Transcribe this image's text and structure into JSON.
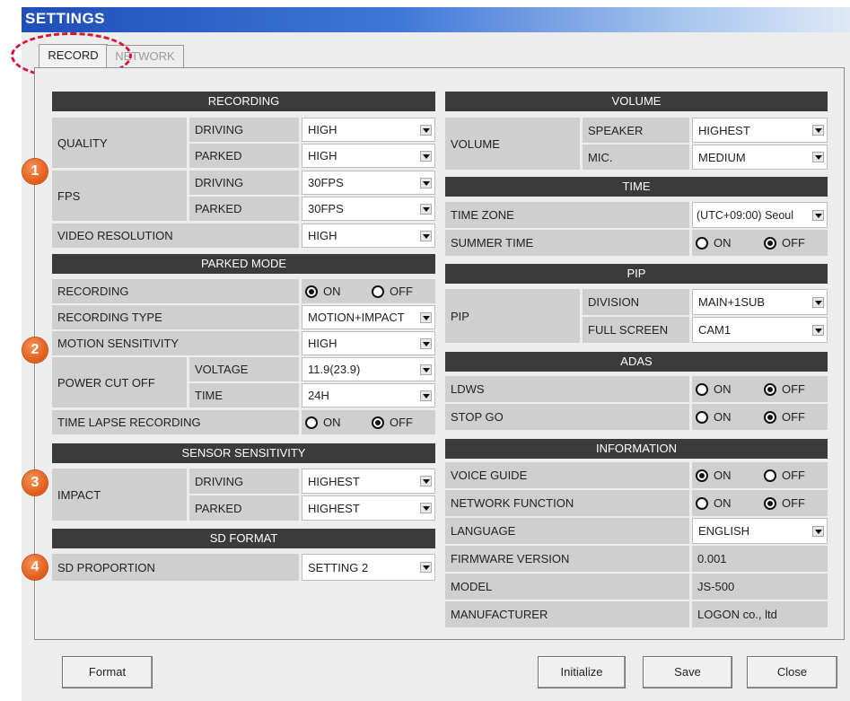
{
  "window": {
    "title": "SETTINGS"
  },
  "tabs": [
    {
      "label": "RECORD"
    },
    {
      "label": "NETWORK"
    }
  ],
  "badges": [
    "1",
    "2",
    "3",
    "4"
  ],
  "left": {
    "recording": {
      "header": "RECORDING",
      "quality_label": "QUALITY",
      "driving_label": "DRIVING",
      "parked_label": "PARKED",
      "quality_driving": "HIGH",
      "quality_parked": "HIGH",
      "fps_label": "FPS",
      "fps_driving": "30FPS",
      "fps_parked": "30FPS",
      "video_resolution_label": "VIDEO RESOLUTION",
      "video_resolution": "HIGH"
    },
    "parked_mode": {
      "header": "PARKED MODE",
      "recording_label": "RECORDING",
      "recording_on": "ON",
      "recording_off": "OFF",
      "recording_type_label": "RECORDING TYPE",
      "recording_type": "MOTION+IMPACT",
      "motion_sensitivity_label": "MOTION SENSITIVITY",
      "motion_sensitivity": "HIGH",
      "power_cut_off_label": "POWER CUT OFF",
      "voltage_label": "VOLTAGE",
      "voltage": "11.9(23.9)",
      "time_label": "TIME",
      "time": "24H",
      "time_lapse_label": "TIME LAPSE RECORDING",
      "time_lapse_on": "ON",
      "time_lapse_off": "OFF"
    },
    "sensor": {
      "header": "SENSOR SENSITIVITY",
      "impact_label": "IMPACT",
      "driving_label": "DRIVING",
      "parked_label": "PARKED",
      "impact_driving": "HIGHEST",
      "impact_parked": "HIGHEST"
    },
    "sd_format": {
      "header": "SD FORMAT",
      "proportion_label": "SD PROPORTION",
      "proportion": "SETTING 2"
    }
  },
  "right": {
    "volume": {
      "header": "VOLUME",
      "volume_label": "VOLUME",
      "speaker_label": "SPEAKER",
      "speaker": "HIGHEST",
      "mic_label": "MIC.",
      "mic": "MEDIUM"
    },
    "time": {
      "header": "TIME",
      "timezone_label": "TIME ZONE",
      "timezone": "(UTC+09:00) Seoul",
      "summer_label": "SUMMER TIME",
      "summer_on": "ON",
      "summer_off": "OFF"
    },
    "pip": {
      "header": "PIP",
      "pip_label": "PIP",
      "division_label": "DIVISION",
      "division": "MAIN+1SUB",
      "fullscreen_label": "FULL SCREEN",
      "fullscreen": "CAM1"
    },
    "adas": {
      "header": "ADAS",
      "ldws_label": "LDWS",
      "ldws_on": "ON",
      "ldws_off": "OFF",
      "stopgo_label": "STOP GO",
      "stopgo_on": "ON",
      "stopgo_off": "OFF"
    },
    "information": {
      "header": "INFORMATION",
      "voice_label": "VOICE GUIDE",
      "voice_on": "ON",
      "voice_off": "OFF",
      "network_label": "NETWORK FUNCTION",
      "network_on": "ON",
      "network_off": "OFF",
      "language_label": "LANGUAGE",
      "language": "ENGLISH",
      "firmware_label": "FIRMWARE VERSION",
      "firmware": "0.001",
      "model_label": "MODEL",
      "model": "JS-500",
      "manufacturer_label": "MANUFACTURER",
      "manufacturer": "LOGON co., ltd"
    }
  },
  "buttons": {
    "format": "Format",
    "initialize": "Initialize",
    "save": "Save",
    "close": "Close"
  }
}
